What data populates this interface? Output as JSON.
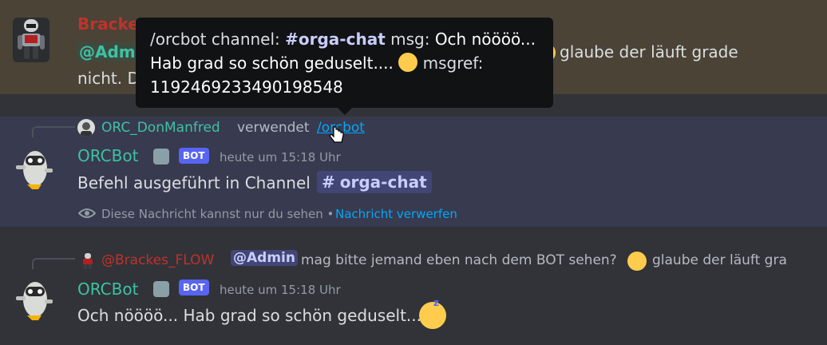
{
  "message1": {
    "author": "Bracke",
    "mention_fragment": "@Adm",
    "text_right": "glaube der läuft grade",
    "text_line2": "nicht. D"
  },
  "tooltip": {
    "cmd": "/orcbot channel: ",
    "channel": "#orga-chat",
    "msg_label": " msg: ",
    "msg_text": "Och nöööö...",
    "line2": "Hab grad so schön geduselt.... ",
    "msgref_label": " msgref:",
    "msgref_value": "1192469233490198548"
  },
  "message2": {
    "reply_user": "ORC_DonManfred",
    "reply_used": "verwendet",
    "reply_command": "/orcbot",
    "author": "ORCBot",
    "badge": "BOT",
    "timestamp": "heute um 15:18 Uhr",
    "text": "Befehl ausgeführt in Channel",
    "channel_hash": "#",
    "channel_name": "orga-chat",
    "ephemeral_text": "Diese Nachricht kannst nur du sehen •",
    "dismiss_link": "Nachricht verwerfen"
  },
  "message3": {
    "reply_user": "@Brackes_FLOW",
    "reply_mention": "@Admin",
    "reply_text": "mag bitte jemand eben nach dem BOT sehen?",
    "reply_text_cut": "glaube der läuft gra",
    "author": "ORCBot",
    "badge": "BOT",
    "timestamp": "heute um 15:18 Uhr",
    "text": "Och nöööö... Hab grad so schön geduselt...."
  },
  "colors": {
    "background": "#313338",
    "highlight_mention": "#4a4336",
    "ephemeral_bg": "#383a4f",
    "bot_name": "#3dc2a4",
    "user_red": "#c0322b",
    "link_blue": "#00a8fc",
    "badge": "#5865f2"
  }
}
